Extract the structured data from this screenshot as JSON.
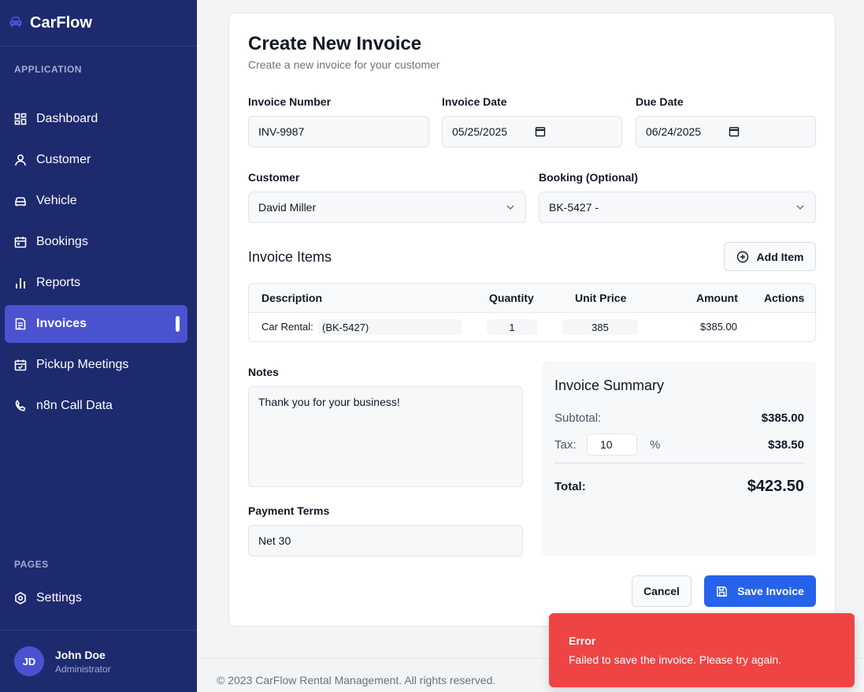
{
  "app": {
    "name": "CarFlow"
  },
  "sidebar": {
    "application_label": "APPLICATION",
    "items": [
      {
        "label": "Dashboard",
        "icon": "dashboard-icon"
      },
      {
        "label": "Customer",
        "icon": "user-icon"
      },
      {
        "label": "Vehicle",
        "icon": "car-icon"
      },
      {
        "label": "Bookings",
        "icon": "calendar-icon"
      },
      {
        "label": "Reports",
        "icon": "bar-chart-icon"
      },
      {
        "label": "Invoices",
        "icon": "invoice-icon",
        "active": true
      },
      {
        "label": "Pickup Meetings",
        "icon": "calendar-check-icon"
      },
      {
        "label": "n8n Call Data",
        "icon": "phone-icon"
      }
    ],
    "pages_label": "PAGES",
    "pages": [
      {
        "label": "Settings",
        "icon": "gear-icon"
      }
    ],
    "user": {
      "initials": "JD",
      "name": "John Doe",
      "role": "Administrator"
    }
  },
  "form": {
    "title": "Create New Invoice",
    "subtitle": "Create a new invoice for your customer",
    "invoice_number_label": "Invoice Number",
    "invoice_number": "INV-9987",
    "invoice_date_label": "Invoice Date",
    "invoice_date": "05/25/2025",
    "due_date_label": "Due Date",
    "due_date": "06/24/2025",
    "customer_label": "Customer",
    "customer": "David Miller",
    "booking_label": "Booking (Optional)",
    "booking": "BK-5427 -",
    "items_title": "Invoice Items",
    "add_item_label": "Add Item",
    "table": {
      "headers": {
        "description": "Description",
        "quantity": "Quantity",
        "unit_price": "Unit Price",
        "amount": "Amount",
        "actions": "Actions"
      },
      "rows": [
        {
          "description_prefix": "Car Rental:",
          "description_ref": "(BK-5427)",
          "quantity": "1",
          "unit_price": "385",
          "amount": "$385.00"
        }
      ]
    },
    "notes_label": "Notes",
    "notes": "Thank you for your business!",
    "payment_terms_label": "Payment Terms",
    "payment_terms": "Net 30",
    "summary": {
      "title": "Invoice Summary",
      "subtotal_label": "Subtotal:",
      "subtotal": "$385.00",
      "tax_label": "Tax:",
      "tax_rate": "10",
      "tax_unit": "%",
      "tax_amount": "$38.50",
      "total_label": "Total:",
      "total": "$423.50"
    },
    "cancel_label": "Cancel",
    "save_label": "Save Invoice"
  },
  "footer": {
    "text": "© 2023 CarFlow Rental Management. All rights reserved."
  },
  "toast": {
    "title": "Error",
    "message": "Failed to save the invoice. Please try again."
  },
  "colors": {
    "sidebar": "#1e2a6e",
    "active": "#4a52d0",
    "primary": "#2563eb",
    "error": "#ef4444"
  }
}
